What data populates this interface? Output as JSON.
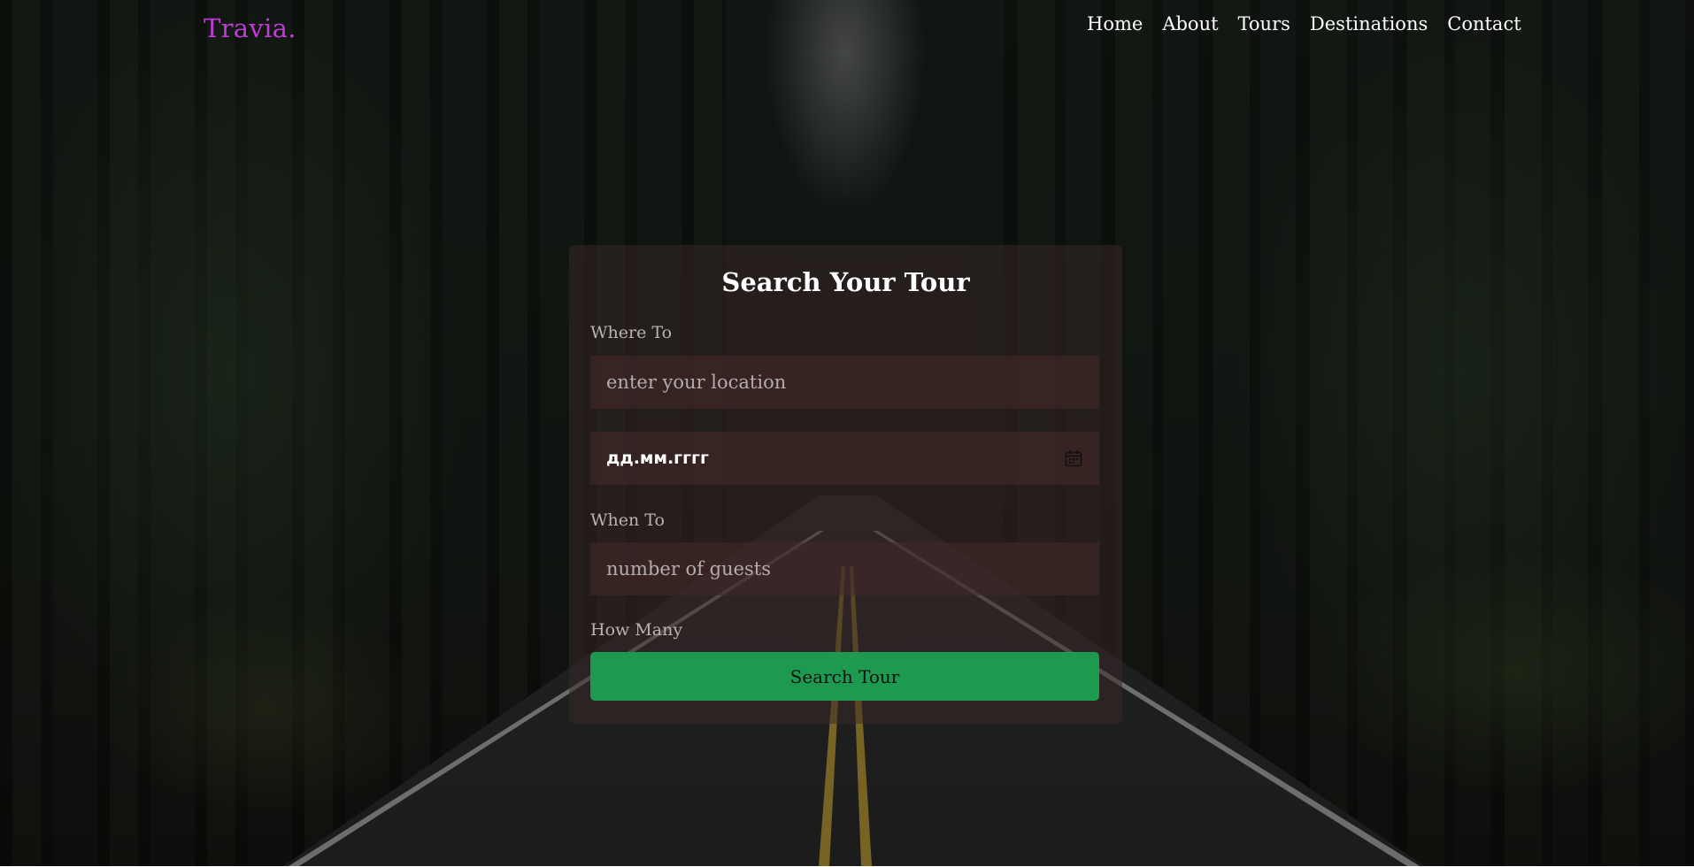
{
  "brand": {
    "logo": "Travia.",
    "logo_color": "#c23ad9"
  },
  "nav": {
    "items": [
      "Home",
      "About",
      "Tours",
      "Destinations",
      "Contact"
    ]
  },
  "search_form": {
    "title": "Search Your Tour",
    "where_label": "Where To",
    "location_placeholder": "enter your location",
    "date_placeholder": "дд.мм.гггг",
    "when_label": "When To",
    "guests_placeholder": "number of guests",
    "how_many_label": "How Many",
    "submit_label": "Search Tour",
    "submit_color": "#1e9a50",
    "date_icon": "calendar-icon"
  }
}
